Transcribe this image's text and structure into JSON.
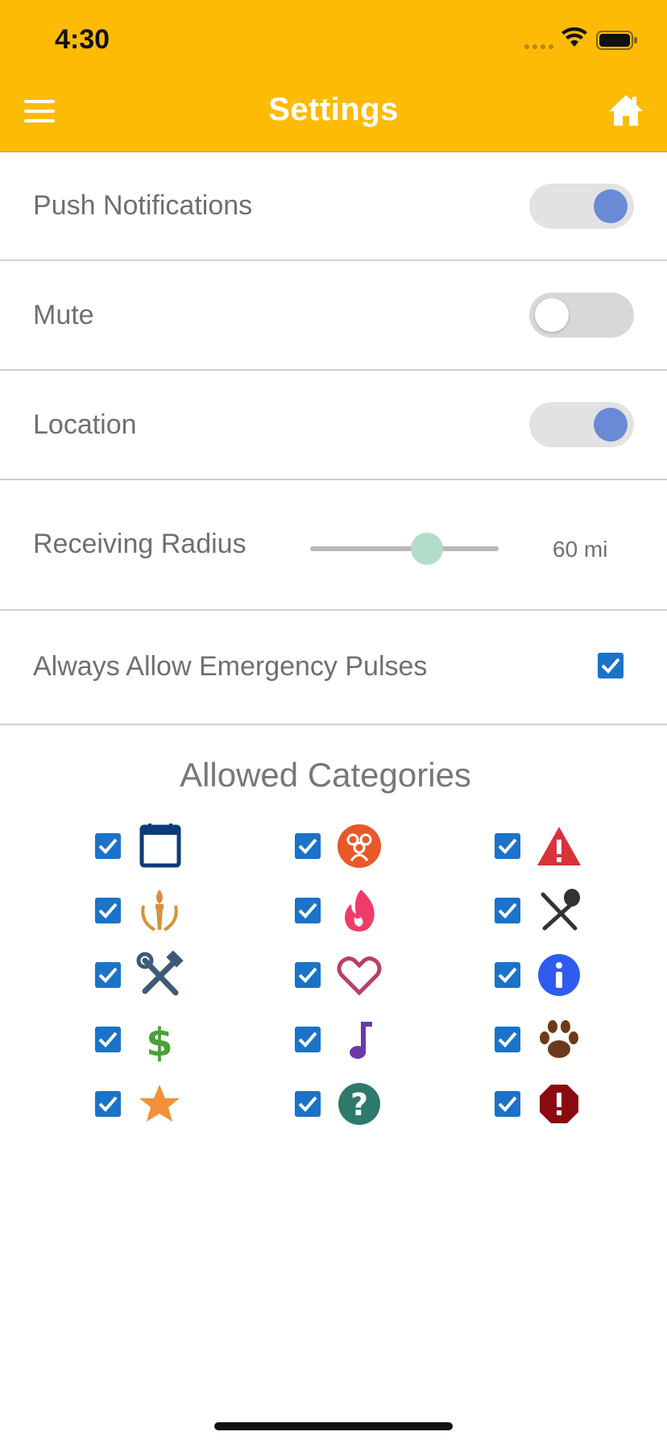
{
  "status_bar": {
    "time": "4:30"
  },
  "header": {
    "title": "Settings"
  },
  "settings": {
    "push_notifications": {
      "label": "Push Notifications",
      "enabled": true
    },
    "mute": {
      "label": "Mute",
      "enabled": false
    },
    "location": {
      "label": "Location",
      "enabled": true
    },
    "receiving_radius": {
      "label": "Receiving Radius",
      "value_text": "60 mi",
      "value": 60,
      "slider_fraction": 0.62
    },
    "emergency_pulses": {
      "label": "Always Allow Emergency Pulses",
      "checked": true
    }
  },
  "categories": {
    "title": "Allowed Categories",
    "items": [
      {
        "icon": "calendar-icon",
        "checked": true,
        "color": "#0d3a7a"
      },
      {
        "icon": "group-icon",
        "checked": true,
        "color": "#e8582a"
      },
      {
        "icon": "warning-icon",
        "checked": true,
        "color": "#d8323a"
      },
      {
        "icon": "torch-laurel-icon",
        "checked": true,
        "color": "#d4933a"
      },
      {
        "icon": "flame-icon",
        "checked": true,
        "color": "#f03a6a"
      },
      {
        "icon": "fork-spoon-icon",
        "checked": true,
        "color": "#333333"
      },
      {
        "icon": "tools-icon",
        "checked": true,
        "color": "#3d5a7a"
      },
      {
        "icon": "heart-icon",
        "checked": true,
        "color": "#b8406a"
      },
      {
        "icon": "info-icon",
        "checked": true,
        "color": "#2f5cf0"
      },
      {
        "icon": "dollar-icon",
        "checked": true,
        "color": "#4aa03a"
      },
      {
        "icon": "music-note-icon",
        "checked": true,
        "color": "#6b3aa8"
      },
      {
        "icon": "paw-icon",
        "checked": true,
        "color": "#6b3a18"
      },
      {
        "icon": "star-icon",
        "checked": true,
        "color": "#f0903a"
      },
      {
        "icon": "question-icon",
        "checked": true,
        "color": "#2e7a6a"
      },
      {
        "icon": "alert-octagon-icon",
        "checked": true,
        "color": "#8a0a10"
      }
    ]
  },
  "colors": {
    "header": "#FDBB06",
    "toggle_on": "#6b8ad6",
    "checkbox": "#1a73c8",
    "slider_thumb": "#b4ddc9"
  }
}
